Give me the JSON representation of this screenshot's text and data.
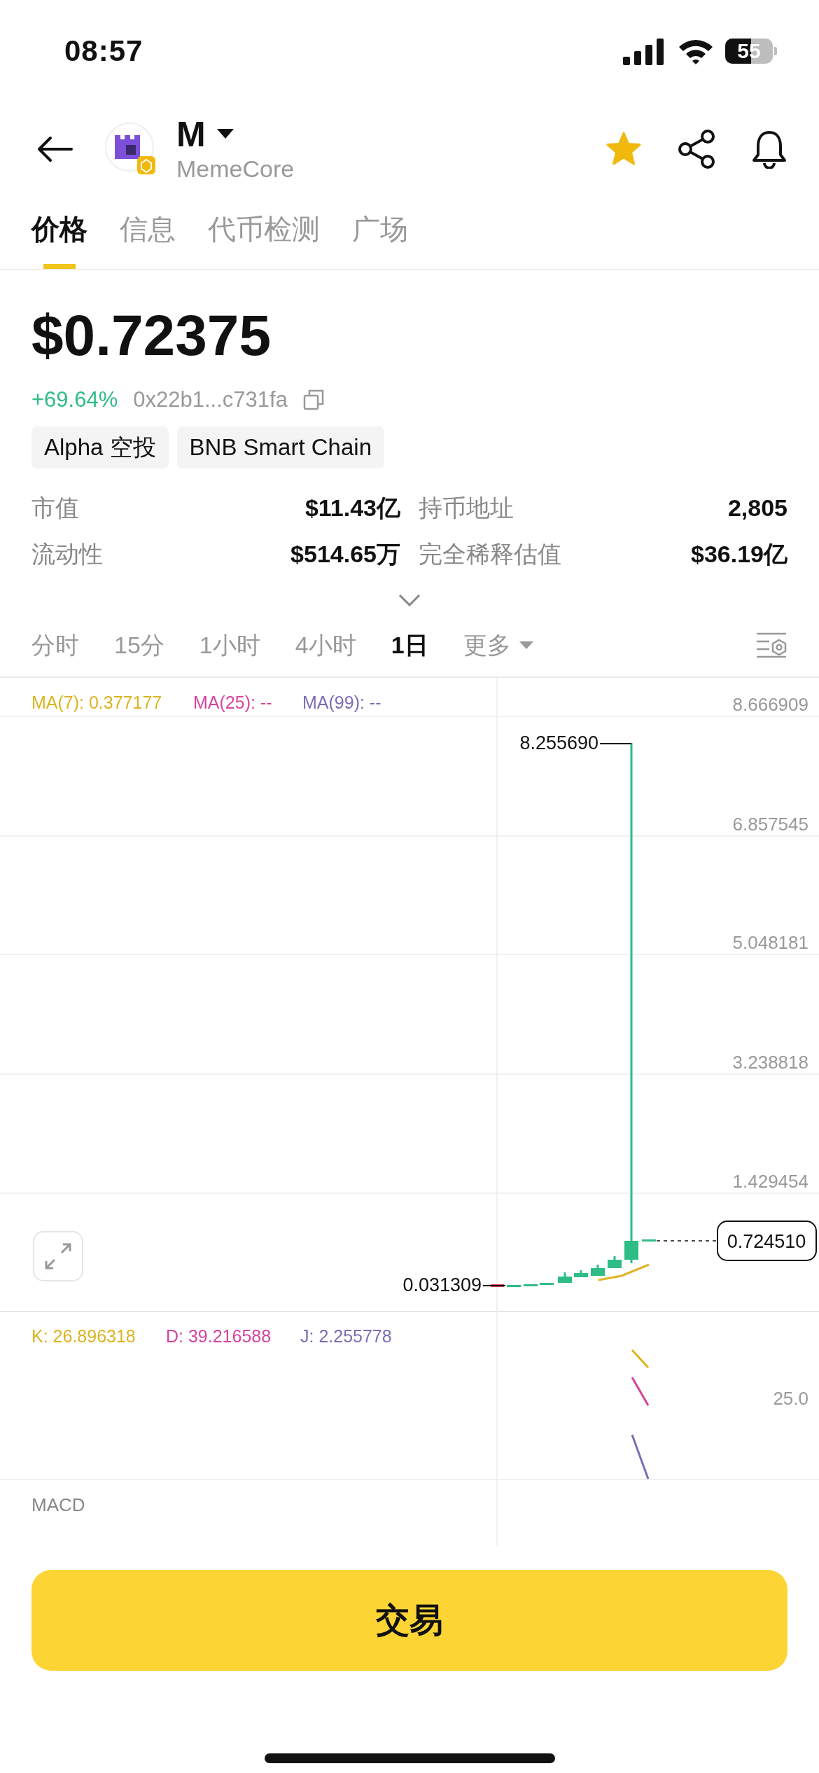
{
  "status_bar": {
    "time": "08:57",
    "battery": "55"
  },
  "header": {
    "symbol": "M",
    "name": "MemeCore",
    "favorite": true
  },
  "tabs": [
    {
      "label": "价格",
      "selected": true
    },
    {
      "label": "信息",
      "selected": false
    },
    {
      "label": "代币检测",
      "selected": false
    },
    {
      "label": "广场",
      "selected": false
    }
  ],
  "price": "$0.72375",
  "change": "+69.64%",
  "address": "0x22b1...c731fa",
  "tags": [
    "Alpha 空投",
    "BNB Smart Chain"
  ],
  "stats": [
    {
      "label": "市值",
      "value": "$11.43亿"
    },
    {
      "label": "持币地址",
      "value": "2,805"
    },
    {
      "label": "流动性",
      "value": "$514.65万"
    },
    {
      "label": "完全稀释估值",
      "value": "$36.19亿"
    }
  ],
  "timeframes": [
    {
      "label": "分时",
      "selected": false,
      "kind": "plain"
    },
    {
      "label": "15分",
      "selected": false,
      "kind": "plain"
    },
    {
      "label": "1小时",
      "selected": false,
      "kind": "plain"
    },
    {
      "label": "4小时",
      "selected": false,
      "kind": "plain"
    },
    {
      "label": "1日",
      "selected": true,
      "kind": "plain"
    },
    {
      "label": "更多",
      "selected": false,
      "kind": "dropdown"
    }
  ],
  "chart": {
    "ma_legend": [
      {
        "label": "MA(7): 0.377177",
        "color": "#dcb31f"
      },
      {
        "label": "MA(25): --",
        "color": "#d6439f"
      },
      {
        "label": "MA(99): --",
        "color": "#7e6bb5"
      }
    ],
    "y_labels": [
      "8.666909",
      "6.857545",
      "5.048181",
      "3.238818",
      "1.429454"
    ],
    "high_label": "8.255690",
    "low_label": "0.031309",
    "last_price": "0.724510"
  },
  "kdj": {
    "legend": [
      {
        "label": "K: 26.896318",
        "color": "#dcb31f"
      },
      {
        "label": "D: 39.216588",
        "color": "#d6439f"
      },
      {
        "label": "J: 2.255778",
        "color": "#7e6bb5"
      }
    ],
    "y_label": "25.0"
  },
  "macd": {
    "label": "MACD"
  },
  "trade_button": "交易"
}
